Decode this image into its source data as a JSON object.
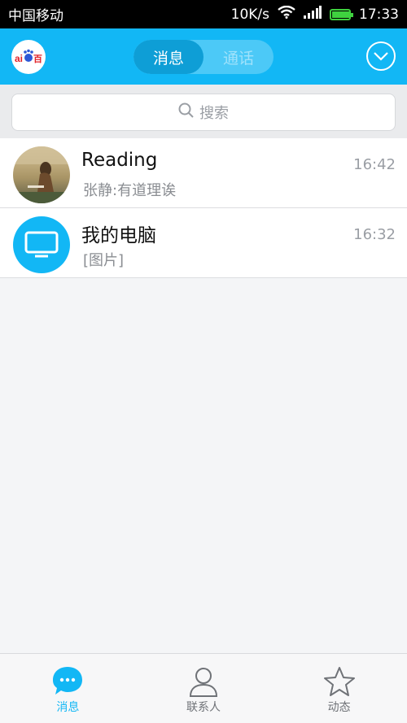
{
  "status_bar": {
    "carrier": "中国移动",
    "speed": "10K/s",
    "time": "17:33",
    "battery_level": 0.95
  },
  "header": {
    "logo_text": "aiᴅᴜ百",
    "tabs": [
      {
        "label": "消息",
        "active": true
      },
      {
        "label": "通话",
        "active": false
      }
    ]
  },
  "search": {
    "placeholder": "搜索"
  },
  "conversations": [
    {
      "name": "Reading",
      "message": "张静:有道理诶",
      "time": "16:42",
      "avatar": "photo"
    },
    {
      "name": "我的电脑",
      "message": "[图片]",
      "time": "16:32",
      "avatar": "monitor-icon"
    }
  ],
  "bottom_nav": [
    {
      "label": "消息",
      "icon": "chat-bubble-icon",
      "active": true
    },
    {
      "label": "联系人",
      "icon": "contact-person-icon",
      "active": false
    },
    {
      "label": "动态",
      "icon": "star-icon",
      "active": false
    }
  ],
  "colors": {
    "accent": "#12b7f5",
    "status_bg": "#000000",
    "list_bg": "#f4f5f7"
  }
}
